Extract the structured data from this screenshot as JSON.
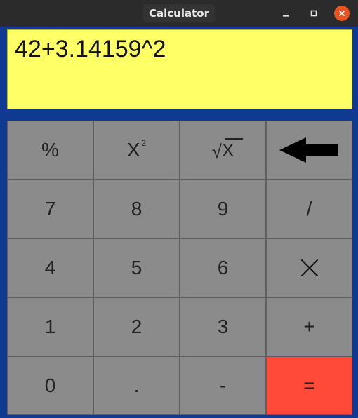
{
  "window": {
    "title": "Calculator"
  },
  "display": {
    "expression": "42+3.14159^2"
  },
  "buttons": [
    {
      "key": "percent",
      "label": "%"
    },
    {
      "key": "square",
      "label": "X",
      "sup": "2"
    },
    {
      "key": "sqrt",
      "label": "X"
    },
    {
      "key": "backspace",
      "label": ""
    },
    {
      "key": "7",
      "label": "7"
    },
    {
      "key": "8",
      "label": "8"
    },
    {
      "key": "9",
      "label": "9"
    },
    {
      "key": "divide",
      "label": "/"
    },
    {
      "key": "4",
      "label": "4"
    },
    {
      "key": "5",
      "label": "5"
    },
    {
      "key": "6",
      "label": "6"
    },
    {
      "key": "multiply",
      "label": ""
    },
    {
      "key": "1",
      "label": "1"
    },
    {
      "key": "2",
      "label": "2"
    },
    {
      "key": "3",
      "label": "3"
    },
    {
      "key": "plus",
      "label": "+"
    },
    {
      "key": "0",
      "label": "0"
    },
    {
      "key": "dot",
      "label": "."
    },
    {
      "key": "minus",
      "label": "-"
    },
    {
      "key": "equals",
      "label": "="
    }
  ],
  "colors": {
    "window_bg": "#0f3a8f",
    "display_bg": "#ffff66",
    "button_bg": "#8b8b8b",
    "equals_bg": "#ff4a3a",
    "titlebar_bg": "#2b2b2b",
    "close_bg": "#e95420"
  },
  "icons": {
    "minimize": "minimize-icon",
    "maximize": "maximize-icon",
    "close": "close-icon",
    "backspace": "back-arrow-icon",
    "multiply": "multiply-x-icon",
    "sqrt": "square-root-icon"
  }
}
